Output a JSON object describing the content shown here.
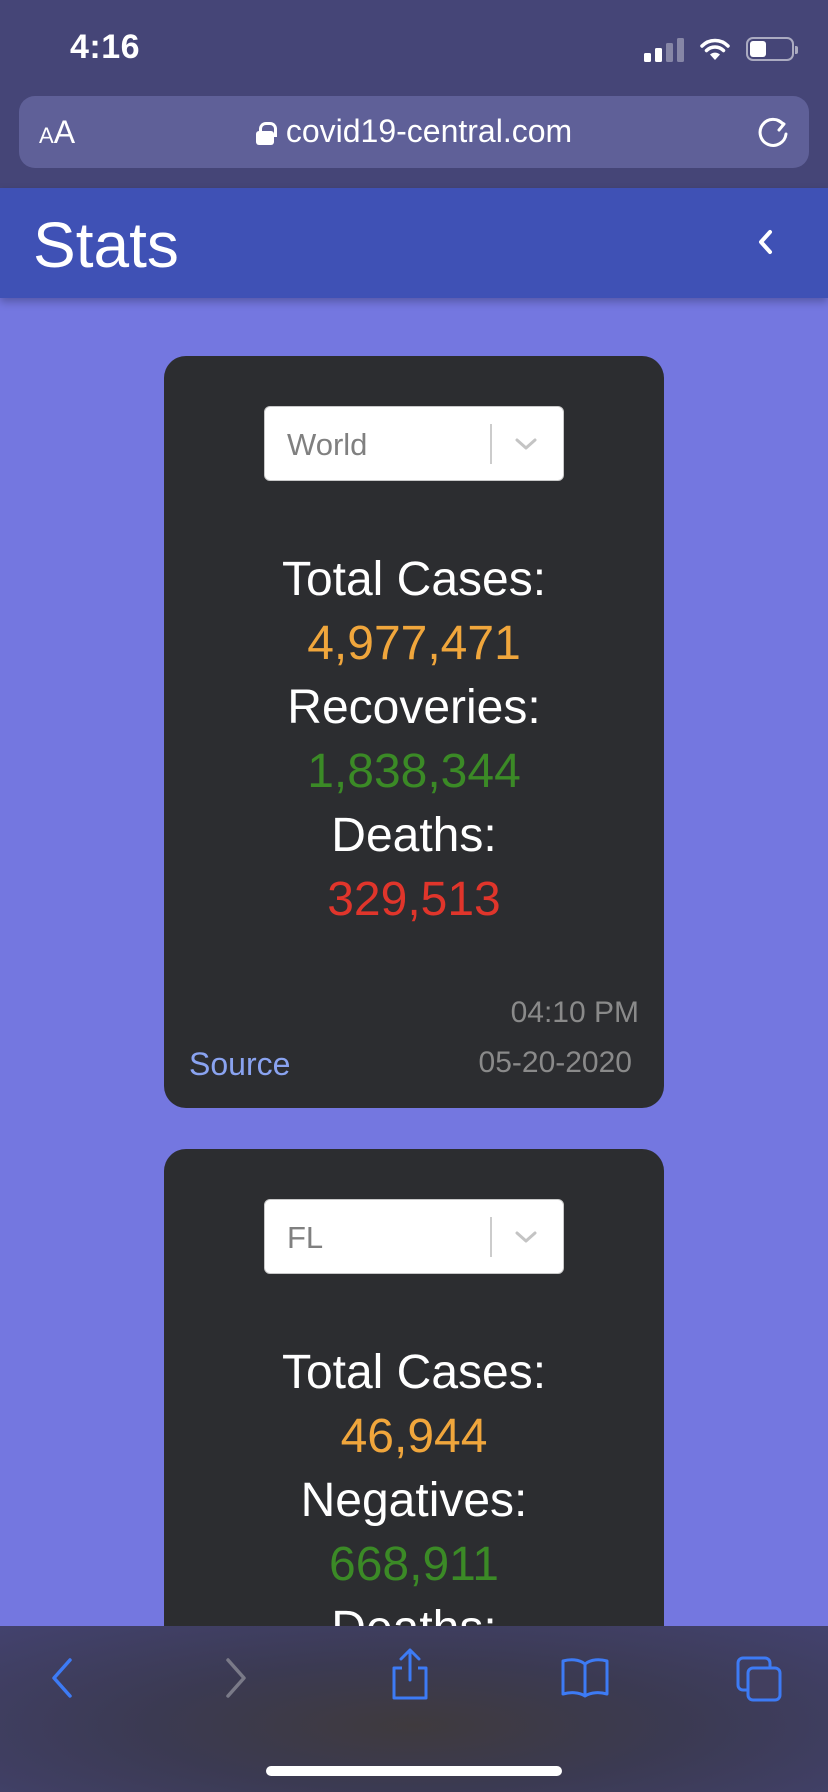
{
  "status_bar": {
    "time": "4:16"
  },
  "browser": {
    "text_size_label_small": "A",
    "text_size_label_large": "A",
    "url": "covid19-central.com"
  },
  "header": {
    "title": "Stats"
  },
  "cards": [
    {
      "region": "World",
      "stats": [
        {
          "label": "Total Cases:",
          "value": "4,977,471",
          "color": "#f0a63c"
        },
        {
          "label": "Recoveries:",
          "value": "1,838,344",
          "color": "#3b8a26"
        },
        {
          "label": "Deaths:",
          "value": "329,513",
          "color": "#e0352b"
        }
      ],
      "time": "04:10 PM",
      "date": "05-20-2020",
      "source_label": "Source"
    },
    {
      "region": "FL",
      "stats": [
        {
          "label": "Total Cases:",
          "value": "46,944",
          "color": "#f0a63c"
        },
        {
          "label": "Negatives:",
          "value": "668,911",
          "color": "#3b8a26"
        },
        {
          "label": "Deaths:",
          "value": "",
          "color": "#e0352b"
        }
      ]
    }
  ],
  "colors": {
    "page_background": "#7477e0",
    "app_bar": "#3f51b5",
    "card": "#2c2d30",
    "link": "#8aa3f0",
    "toolbar_icon": "#3d7bf5"
  },
  "icons": {
    "status": [
      "cellular-signal-icon",
      "wifi-icon",
      "battery-icon"
    ],
    "browser": [
      "lock-icon",
      "reload-icon"
    ],
    "toolbar": [
      "back-icon",
      "forward-icon",
      "share-icon",
      "bookmarks-icon",
      "tabs-icon"
    ]
  }
}
